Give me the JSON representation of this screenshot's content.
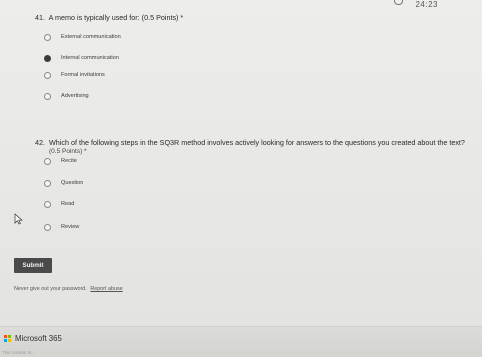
{
  "timer": {
    "value": "24:23"
  },
  "questions": [
    {
      "number": "41.",
      "text": "A memo is typically used for: (0.5 Points) *",
      "options": [
        {
          "label": "External communication",
          "selected": false
        },
        {
          "label": "Internal communication",
          "selected": true
        },
        {
          "label": "Formal invitations",
          "selected": false
        },
        {
          "label": "Advertising",
          "selected": false
        }
      ]
    },
    {
      "number": "42.",
      "text": "Which of the following steps in the SQ3R method involves actively looking for answers to the questions you created about the text?",
      "points": "(0.5 Points) *",
      "options": [
        {
          "label": "Recite",
          "selected": false
        },
        {
          "label": "Question",
          "selected": false
        },
        {
          "label": "Read",
          "selected": false
        },
        {
          "label": "Review",
          "selected": false
        }
      ]
    }
  ],
  "submit_label": "Submit",
  "footer": {
    "note": "Never give out your password.",
    "link": "Report abuse"
  },
  "brand": {
    "name": "Microsoft 365",
    "logo_colors": [
      "#f25022",
      "#7fba00",
      "#00a4ef",
      "#ffb900"
    ]
  },
  "bottom_text": "This content is..."
}
